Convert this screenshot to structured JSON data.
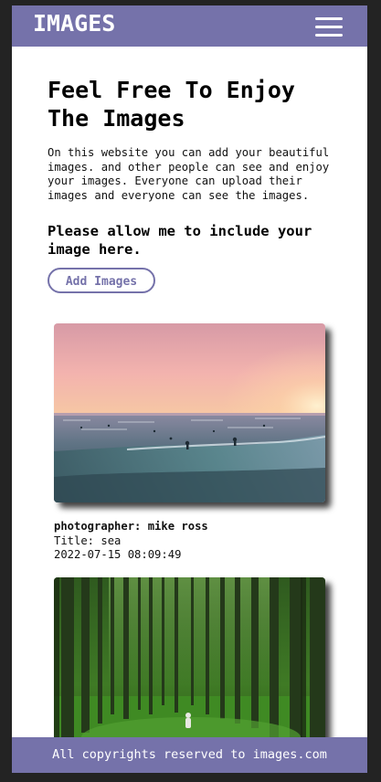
{
  "header": {
    "brand": "IMAGES",
    "menu_icon": "hamburger-menu-icon",
    "background_color": "#7572aa"
  },
  "hero": {
    "title": "Feel Free To Enjoy The Images",
    "description": "On this website you can add your beautiful images. and other people can see and enjoy your images. Everyone can upload their images and everyone can see the images.",
    "note": "Please allow me to include your image here.",
    "add_button_label": "Add Images"
  },
  "images": [
    {
      "photographer": "photographer: mike ross",
      "title": "Title: sea",
      "date": "2022-07-15 08:09:49"
    },
    {
      "photographer": "",
      "title": "",
      "date": ""
    }
  ],
  "footer": {
    "text": "All copyrights reserved to images.com"
  }
}
